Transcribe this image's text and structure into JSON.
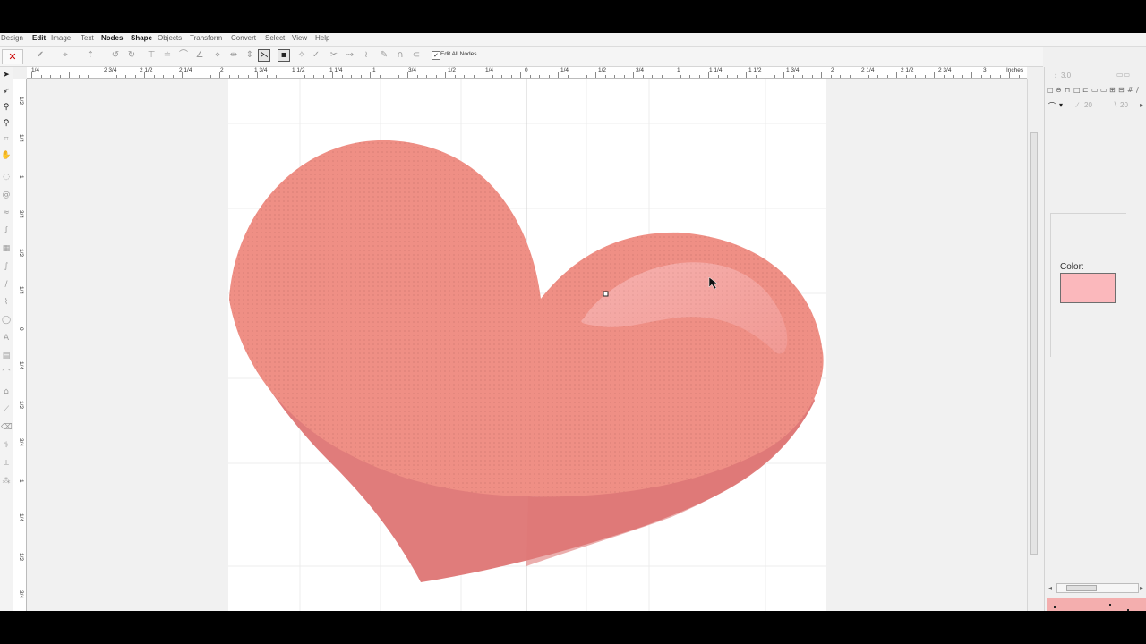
{
  "menu": {
    "items": [
      {
        "label": "Design",
        "bold": false
      },
      {
        "label": "Edit",
        "bold": true
      },
      {
        "label": "Image",
        "bold": false
      },
      {
        "label": "Text",
        "bold": false
      },
      {
        "label": "Nodes",
        "bold": true
      },
      {
        "label": "Shape",
        "bold": true
      },
      {
        "label": "Objects",
        "bold": false
      },
      {
        "label": "Transform",
        "bold": false
      },
      {
        "label": "Convert",
        "bold": false
      },
      {
        "label": "Select",
        "bold": false
      },
      {
        "label": "View",
        "bold": false
      },
      {
        "label": "Help",
        "bold": false
      }
    ]
  },
  "toolbar": {
    "close_glyph": "✕",
    "edit_all_nodes": {
      "label": "Edit All Nodes",
      "checked": true,
      "check_glyph": "✓"
    }
  },
  "ruler": {
    "units": "Inches",
    "h_labels": [
      "1/4",
      "2 3/4",
      "2 1/2",
      "2 1/4",
      "2",
      "1 3/4",
      "1 1/2",
      "1 1/4",
      "1",
      "3/4",
      "1/2",
      "1/4",
      "0",
      "1/4",
      "1/2",
      "3/4",
      "1",
      "1 1/4",
      "1 1/2",
      "1 3/4",
      "2",
      "2 1/4",
      "2 1/2",
      "2 3/4",
      "3"
    ],
    "v_labels": [
      "1/2",
      "1/4",
      "1",
      "3/4",
      "1/2",
      "1/4",
      "0",
      "1/4",
      "1/2",
      "3/4",
      "1",
      "1/4",
      "1/2",
      "3/4"
    ]
  },
  "right_panel": {
    "thickness": "3.0",
    "angle_a": "20",
    "angle_b": "20",
    "color_label": "Color:",
    "color_value": "#fbb8bc"
  },
  "colors": {
    "heart_top": "#ef8f85",
    "heart_side": "#e07c7b",
    "highlight": "#f4aaa8",
    "preview_bg": "#f4aeae"
  }
}
